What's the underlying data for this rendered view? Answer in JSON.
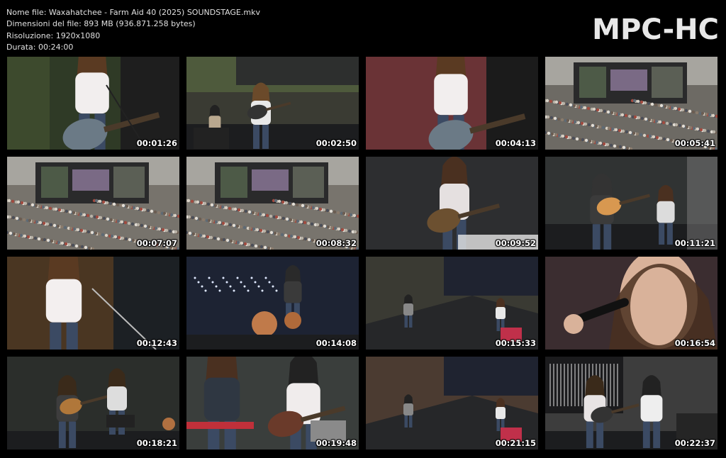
{
  "info": {
    "filename": "Nome file: Waxahatchee - Farm Aid 40 (2025) SOUNDSTAGE.mkv",
    "filesize": "Dimensioni del file: 893 MB (936.871.258 bytes)",
    "resolution": "Risoluzione: 1920x1080",
    "duration": "Durata: 00:24:00"
  },
  "logo": "MPC-HC",
  "thumbnails": [
    {
      "time": "00:01:26",
      "scene": "closeup-singer-guitar",
      "bg": "#2f3a26"
    },
    {
      "time": "00:02:50",
      "scene": "wide-stage-band",
      "bg": "#3a3b33"
    },
    {
      "time": "00:04:13",
      "scene": "closeup-singer-guitar-red",
      "bg": "#5a2e30"
    },
    {
      "time": "00:05:41",
      "scene": "stadium-crowd",
      "bg": "#6d6a64"
    },
    {
      "time": "00:07:07",
      "scene": "stadium-crowd-screens",
      "bg": "#77736c"
    },
    {
      "time": "00:08:32",
      "scene": "stadium-crowd-screens",
      "bg": "#78746d"
    },
    {
      "time": "00:09:52",
      "scene": "singer-dark-stage",
      "bg": "#2a2b2c"
    },
    {
      "time": "00:11:21",
      "scene": "band-wide-stage",
      "bg": "#303333"
    },
    {
      "time": "00:12:43",
      "scene": "closeup-singer-mic",
      "bg": "#3c2f22"
    },
    {
      "time": "00:14:08",
      "scene": "drummer-stage",
      "bg": "#1f2535"
    },
    {
      "time": "00:15:33",
      "scene": "overhead-stage",
      "bg": "#33332e"
    },
    {
      "time": "00:16:54",
      "scene": "extreme-closeup-singer",
      "bg": "#3b2a2c"
    },
    {
      "time": "00:18:21",
      "scene": "two-guitarists",
      "bg": "#2a2d2a"
    },
    {
      "time": "00:19:48",
      "scene": "keyboard-and-bassist",
      "bg": "#303436"
    },
    {
      "time": "00:21:15",
      "scene": "overhead-stage-red",
      "bg": "#3a3430"
    },
    {
      "time": "00:22:37",
      "scene": "two-singers-stage",
      "bg": "#3c3c3c"
    }
  ]
}
